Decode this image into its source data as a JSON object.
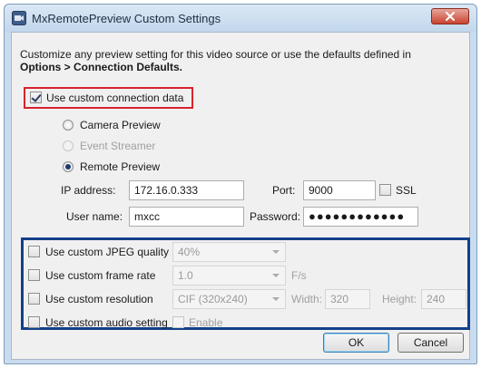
{
  "window": {
    "title": "MxRemotePreview Custom Settings",
    "app_icon": "camera-app-icon",
    "close_icon": "close-icon"
  },
  "intro": {
    "line1": "Customize any preview setting for this video source or use the defaults defined in",
    "line2": "Options > Connection Defaults."
  },
  "connection": {
    "use_custom_label": "Use custom connection data",
    "use_custom_checked": true,
    "camera_preview_label": "Camera Preview",
    "event_streamer_label": "Event Streamer",
    "remote_preview_label": "Remote Preview",
    "selected_mode": "Remote Preview",
    "ip_label": "IP address:",
    "ip_value": "172.16.0.333",
    "port_label": "Port:",
    "port_value": "9000",
    "ssl_label": "SSL",
    "ssl_checked": false,
    "username_label": "User name:",
    "username_value": "mxcc",
    "password_label": "Password:",
    "password_value": "●●●●●●●●●●●●"
  },
  "custom": {
    "jpeg_label": "Use custom JPEG quality",
    "jpeg_value": "40%",
    "frame_rate_label": "Use custom frame rate",
    "frame_rate_value": "1.0",
    "frame_rate_unit": "F/s",
    "resolution_label": "Use custom resolution",
    "resolution_value": "CIF (320x240)",
    "width_label": "Width:",
    "width_value": "320",
    "height_label": "Height:",
    "height_value": "240",
    "audio_label": "Use custom audio setting",
    "enable_label": "Enable"
  },
  "buttons": {
    "ok": "OK",
    "cancel": "Cancel"
  },
  "colors": {
    "highlight_red": "#d8232a",
    "highlight_blue": "#12408a"
  }
}
